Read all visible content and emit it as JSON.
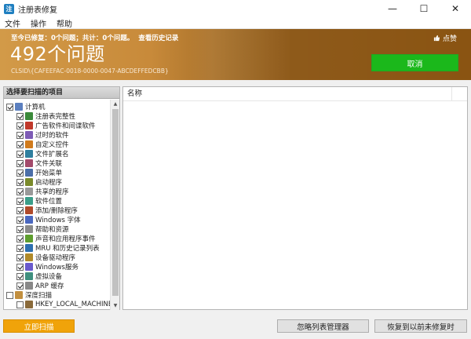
{
  "window": {
    "title": "注册表修复",
    "app_icon_text": "注",
    "buttons": {
      "minimize": "—",
      "maximize": "☐",
      "close": "✕"
    }
  },
  "menu": [
    "文件",
    "操作",
    "帮助"
  ],
  "banner": {
    "summary": "至今已修复：0个问题；共计：0个问题。",
    "history_link": "查看历史记录",
    "problem_count": "492个问题",
    "clsid": "CLSID\\{CAFEEFAC-0018-0000-0047-ABCDEFFEDCBB}",
    "like_label": "点赞",
    "cancel_label": "取消",
    "colors": {
      "accent_left": "#d29a48",
      "accent_right": "#8a5412",
      "cancel_green": "#1bb81b"
    }
  },
  "left_panel": {
    "header": "选择要扫描的项目",
    "items": [
      {
        "label": "计算机",
        "checked": true,
        "level": 0,
        "icon": "computer-icon"
      },
      {
        "label": "注册表完整性",
        "checked": true,
        "level": 1,
        "icon": "registry-icon"
      },
      {
        "label": "广告软件和间谍软件",
        "checked": true,
        "level": 1,
        "icon": "adware-icon"
      },
      {
        "label": "过时的软件",
        "checked": true,
        "level": 1,
        "icon": "software-icon"
      },
      {
        "label": "自定义控件",
        "checked": true,
        "level": 1,
        "icon": "control-icon"
      },
      {
        "label": "文件扩展名",
        "checked": true,
        "level": 1,
        "icon": "file-ext-icon"
      },
      {
        "label": "文件关联",
        "checked": true,
        "level": 1,
        "icon": "file-assoc-icon"
      },
      {
        "label": "开始菜单",
        "checked": true,
        "level": 1,
        "icon": "start-menu-icon"
      },
      {
        "label": "启动程序",
        "checked": true,
        "level": 1,
        "icon": "startup-icon"
      },
      {
        "label": "共享的程序",
        "checked": true,
        "level": 1,
        "icon": "shared-icon"
      },
      {
        "label": "软件位置",
        "checked": true,
        "level": 1,
        "icon": "location-icon"
      },
      {
        "label": "添加/删除程序",
        "checked": true,
        "level": 1,
        "icon": "add-remove-icon"
      },
      {
        "label": "Windows 字体",
        "checked": true,
        "level": 1,
        "icon": "font-icon"
      },
      {
        "label": "帮助和资源",
        "checked": true,
        "level": 1,
        "icon": "help-icon"
      },
      {
        "label": "声音和应用程序事件",
        "checked": true,
        "level": 1,
        "icon": "sound-icon"
      },
      {
        "label": "MRU 和历史记录列表",
        "checked": true,
        "level": 1,
        "icon": "mru-icon"
      },
      {
        "label": "设备驱动程序",
        "checked": true,
        "level": 1,
        "icon": "driver-icon"
      },
      {
        "label": "Windows服务",
        "checked": true,
        "level": 1,
        "icon": "service-icon"
      },
      {
        "label": "虚拟设备",
        "checked": true,
        "level": 1,
        "icon": "virtual-device-icon"
      },
      {
        "label": "ARP 缓存",
        "checked": true,
        "level": 1,
        "icon": "arp-icon"
      },
      {
        "label": "深度扫描",
        "checked": false,
        "level": 0,
        "icon": "deep-scan-icon"
      },
      {
        "label": "HKEY_LOCAL_MACHINE",
        "checked": false,
        "level": 1,
        "icon": "hklm-icon"
      }
    ]
  },
  "right_panel": {
    "column_name": "名称"
  },
  "buttons": {
    "scan_now": "立即扫描",
    "ignore_list": "忽略列表管理器",
    "restore": "恢复到以前未修复时"
  }
}
